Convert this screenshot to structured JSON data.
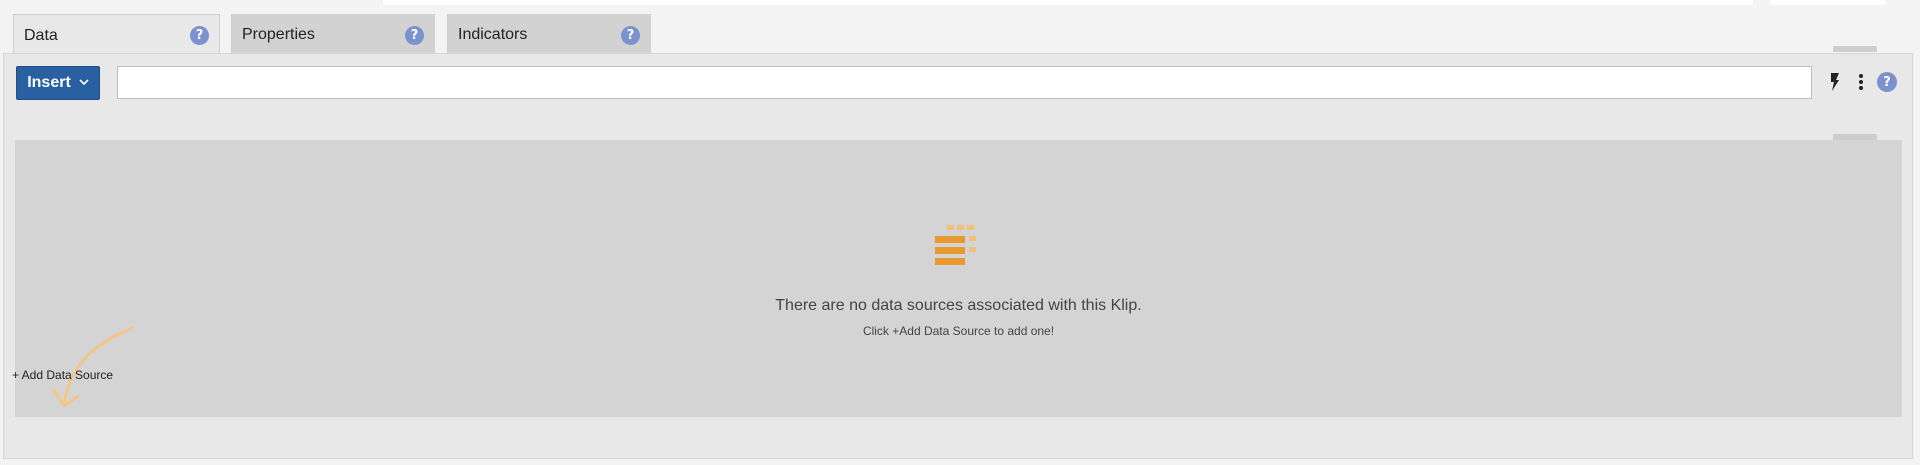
{
  "tabs": [
    {
      "label": "Data",
      "active": true,
      "help_icon": "help-icon"
    },
    {
      "label": "Properties",
      "active": false,
      "help_icon": "help-icon"
    },
    {
      "label": "Indicators",
      "active": false,
      "help_icon": "help-icon"
    }
  ],
  "toolbar": {
    "insert_label": "Insert",
    "insert_chevron": "⌵",
    "formula_value": "",
    "help_glyph": "?",
    "lightning_icon": "lightning-icon",
    "more_icon": "vertical-ellipsis-icon"
  },
  "empty_state": {
    "icon": "data-source-stack-icon",
    "title": "There are no data sources associated with this Klip.",
    "subtitle": "Click +Add Data Source to add one!"
  },
  "add_data_source_label": "+ Add Data Source",
  "colors": {
    "accent": "#2860a2",
    "help": "#7b92cf",
    "icon_orange": "#e89a30",
    "arrow": "#f2c58a"
  }
}
